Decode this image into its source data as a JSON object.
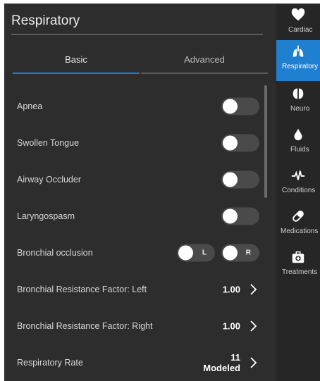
{
  "panel": {
    "title": "Respiratory"
  },
  "tabs": [
    {
      "label": "Basic",
      "active": true
    },
    {
      "label": "Advanced",
      "active": false
    }
  ],
  "rows": {
    "apnea": {
      "label": "Apnea",
      "on": false
    },
    "swollen_tongue": {
      "label": "Swollen Tongue",
      "on": false
    },
    "airway_occluder": {
      "label": "Airway Occluder",
      "on": false
    },
    "laryngospasm": {
      "label": "Laryngospasm",
      "on": false
    },
    "bronchial_occlusion": {
      "label": "Bronchial occlusion",
      "left_label": "L",
      "right_label": "R",
      "left_on": false,
      "right_on": false
    },
    "resistance_left": {
      "label": "Bronchial Resistance Factor: Left",
      "value": "1.00"
    },
    "resistance_right": {
      "label": "Bronchial Resistance Factor: Right",
      "value": "1.00"
    },
    "respiratory_rate": {
      "label": "Respiratory Rate",
      "value": "11",
      "mode": "Modeled"
    }
  },
  "sidebar": {
    "items": [
      {
        "label": "Cardiac",
        "icon": "heart-icon"
      },
      {
        "label": "Respiratory",
        "icon": "lungs-icon",
        "active": true
      },
      {
        "label": "Neuro",
        "icon": "brain-icon"
      },
      {
        "label": "Fluids",
        "icon": "drop-icon"
      },
      {
        "label": "Conditions",
        "icon": "pulse-icon"
      },
      {
        "label": "Medications",
        "icon": "pill-icon"
      },
      {
        "label": "Treatments",
        "icon": "medkit-icon"
      }
    ]
  },
  "colors": {
    "accent": "#1f7fd1",
    "panel_bg": "#2d2d2d",
    "sidebar_bg": "#262626",
    "toggle_track": "#4a4a4a"
  }
}
